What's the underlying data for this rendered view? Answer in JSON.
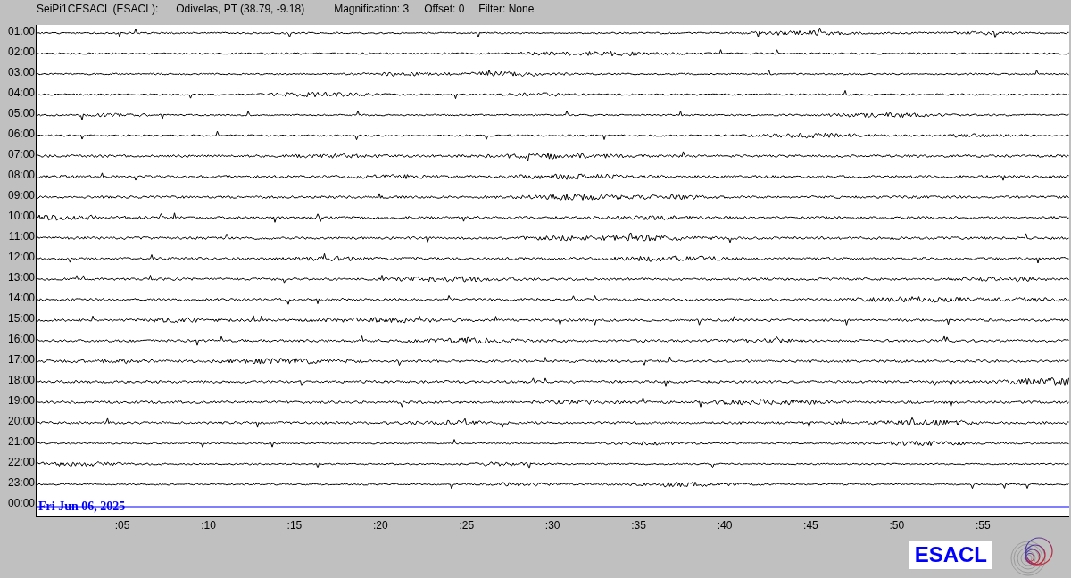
{
  "header": {
    "station": "SeiPi1CESACL (ESACL):",
    "location": "Odivelas, PT (38.79, -9.18)",
    "magnification": "Magnification: 3",
    "offset": "Offset: 0",
    "filter": "Filter: None"
  },
  "rows": [
    {
      "label": "01:00",
      "kind": "trace"
    },
    {
      "label": "02:00",
      "kind": "trace"
    },
    {
      "label": "03:00",
      "kind": "trace"
    },
    {
      "label": "04:00",
      "kind": "trace"
    },
    {
      "label": "05:00",
      "kind": "trace"
    },
    {
      "label": "06:00",
      "kind": "trace"
    },
    {
      "label": "07:00",
      "kind": "trace"
    },
    {
      "label": "08:00",
      "kind": "trace"
    },
    {
      "label": "09:00",
      "kind": "trace"
    },
    {
      "label": "10:00",
      "kind": "trace"
    },
    {
      "label": "11:00",
      "kind": "trace"
    },
    {
      "label": "12:00",
      "kind": "trace"
    },
    {
      "label": "13:00",
      "kind": "trace"
    },
    {
      "label": "14:00",
      "kind": "trace"
    },
    {
      "label": "15:00",
      "kind": "trace"
    },
    {
      "label": "16:00",
      "kind": "trace"
    },
    {
      "label": "17:00",
      "kind": "trace"
    },
    {
      "label": "18:00",
      "kind": "trace"
    },
    {
      "label": "19:00",
      "kind": "trace"
    },
    {
      "label": "20:00",
      "kind": "trace"
    },
    {
      "label": "21:00",
      "kind": "trace"
    },
    {
      "label": "22:00",
      "kind": "trace"
    },
    {
      "label": "23:00",
      "kind": "trace"
    },
    {
      "label": "00:00",
      "kind": "current",
      "date": "Fri Jun 06, 2025"
    }
  ],
  "x_ticks": [
    ":05",
    ":10",
    ":15",
    ":20",
    ":25",
    ":30",
    ":35",
    ":40",
    ":45",
    ":50",
    ":55"
  ],
  "logo": "ESACL"
}
